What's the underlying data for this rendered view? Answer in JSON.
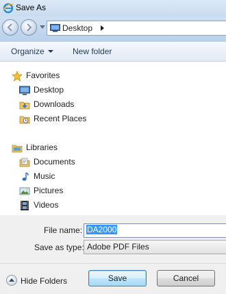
{
  "window": {
    "title": "Save As"
  },
  "address": {
    "crumbs": [
      "Desktop"
    ]
  },
  "toolbar": {
    "organize_label": "Organize",
    "new_folder_label": "New folder"
  },
  "nav": {
    "favorites": {
      "header": "Favorites",
      "items": [
        "Desktop",
        "Downloads",
        "Recent Places"
      ]
    },
    "libraries": {
      "header": "Libraries",
      "items": [
        "Documents",
        "Music",
        "Pictures",
        "Videos"
      ]
    }
  },
  "form": {
    "file_name_label": "File name:",
    "file_name_value": "DA2000",
    "save_type_label": "Save as type:",
    "save_type_value": "Adobe PDF Files"
  },
  "footer": {
    "hide_folders_label": "Hide Folders",
    "save_label": "Save",
    "cancel_label": "Cancel"
  }
}
